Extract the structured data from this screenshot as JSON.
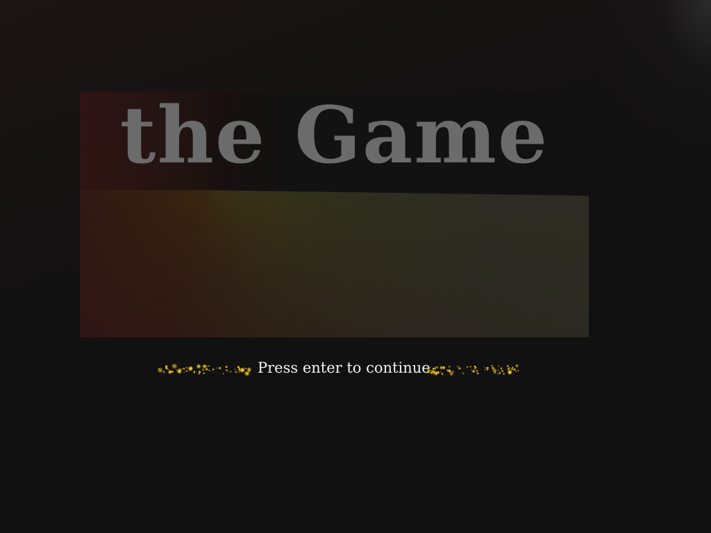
{
  "title": "the Game",
  "prompt": "Press enter to continue",
  "colors": {
    "background": "#111111",
    "title_text": "#6b6b6b",
    "prompt_text": "#f2f2f2",
    "sparkle": "#f5c518"
  },
  "decorations": {
    "left_sparkles_icon": "sparkle-trail-icon",
    "right_sparkles_icon": "sparkle-trail-icon"
  }
}
